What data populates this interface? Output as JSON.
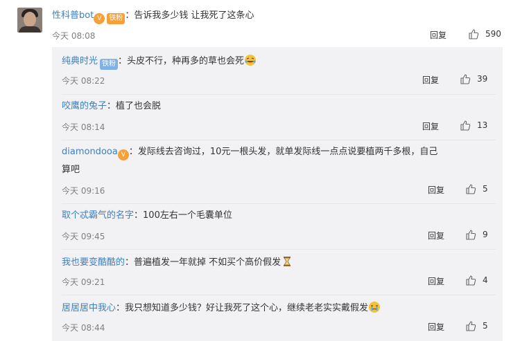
{
  "main": {
    "username": "性科普bot",
    "badge": "铁粉",
    "text": "告诉我多少钱 让我死了这条心",
    "time": "今天 08:08",
    "reply_label": "回复",
    "likes": "590"
  },
  "replies": [
    {
      "username": "纯典时光",
      "badge": "铁粉",
      "text": "头皮不行，种再多的草也会死",
      "emoji": "laugh-cry-emoji",
      "time": "今天 08:22",
      "reply_label": "回复",
      "likes": "39"
    },
    {
      "username": "咬鹰的兔子",
      "text": "植了也会脱",
      "time": "今天 08:14",
      "reply_label": "回复",
      "likes": "13"
    },
    {
      "username": "diamondooa",
      "text": "发际线去咨询过，10元一根头发，就单发际线一点点说要植两千多根，自己",
      "text2": "算吧",
      "time": "今天 09:16",
      "reply_label": "回复",
      "likes": "5"
    },
    {
      "username": "取个忒霸气的名字",
      "text": "100左右一个毛囊单位",
      "time": "今天 09:45",
      "reply_label": "回复",
      "likes": "9"
    },
    {
      "username": "我也要变酷酷的",
      "text": "普遍植发一年就掉  不如买个高价假发",
      "emoji": "hourglass-emoji",
      "time": "今天 09:21",
      "reply_label": "回复",
      "likes": "4"
    },
    {
      "username": "居居居中我心",
      "text": "我只想知道多少钱？好让我死了这个心，继续老老实实戴假发",
      "emoji": "crying-emoji",
      "time": "今天 08:44",
      "reply_label": "回复",
      "likes": "5"
    }
  ]
}
